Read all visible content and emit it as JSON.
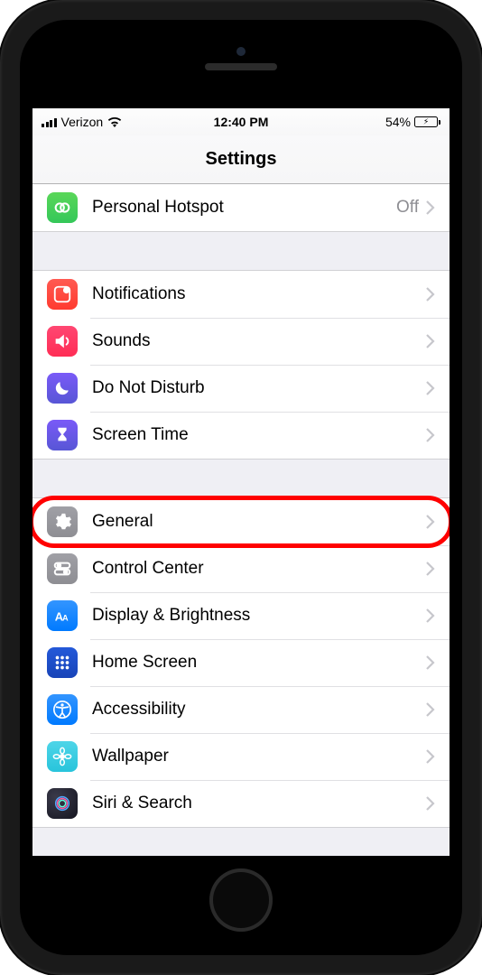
{
  "statusbar": {
    "carrier": "Verizon",
    "time": "12:40 PM",
    "battery_pct": "54%"
  },
  "header": {
    "title": "Settings"
  },
  "groups": [
    {
      "rows": [
        {
          "icon": "hotspot",
          "label": "Personal Hotspot",
          "value": "Off",
          "highlighted": false
        }
      ]
    },
    {
      "rows": [
        {
          "icon": "notifications",
          "label": "Notifications",
          "highlighted": false
        },
        {
          "icon": "sounds",
          "label": "Sounds",
          "highlighted": false
        },
        {
          "icon": "dnd",
          "label": "Do Not Disturb",
          "highlighted": false
        },
        {
          "icon": "screentime",
          "label": "Screen Time",
          "highlighted": false
        }
      ]
    },
    {
      "rows": [
        {
          "icon": "general",
          "label": "General",
          "highlighted": true
        },
        {
          "icon": "controlcenter",
          "label": "Control Center",
          "highlighted": false
        },
        {
          "icon": "display",
          "label": "Display & Brightness",
          "highlighted": false
        },
        {
          "icon": "homescreen",
          "label": "Home Screen",
          "highlighted": false
        },
        {
          "icon": "accessibility",
          "label": "Accessibility",
          "highlighted": false
        },
        {
          "icon": "wallpaper",
          "label": "Wallpaper",
          "highlighted": false
        },
        {
          "icon": "siri",
          "label": "Siri & Search",
          "highlighted": false
        }
      ]
    }
  ]
}
